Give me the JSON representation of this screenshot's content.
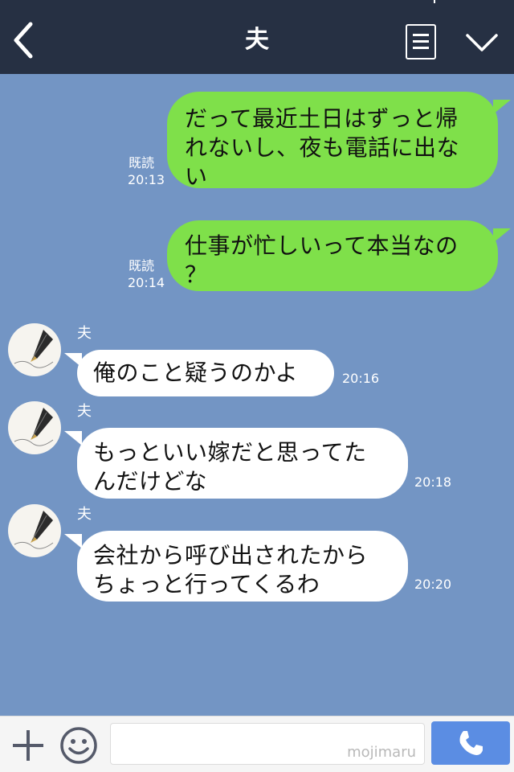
{
  "header": {
    "title": "夫",
    "back_icon": "chevron-left-icon",
    "notes_icon": "note-list-icon",
    "menu_icon": "chevron-down-icon"
  },
  "messages": [
    {
      "direction": "out",
      "lines": [
        "だって最近土日はずっと帰",
        "れないし、夜も電話に出な",
        "い"
      ],
      "read": "既読",
      "time": "20:13"
    },
    {
      "direction": "out",
      "lines": [
        "仕事が忙しいって本当なの",
        "？"
      ],
      "read": "既読",
      "time": "20:14"
    },
    {
      "direction": "in",
      "sender": "夫",
      "lines": [
        "俺のこと疑うのかよ"
      ],
      "time": "20:16"
    },
    {
      "direction": "in",
      "sender": "夫",
      "lines": [
        "もっといい嫁だと思ってた",
        "んだけどな"
      ],
      "time": "20:18"
    },
    {
      "direction": "in",
      "sender": "夫",
      "lines": [
        "会社から呼び出されたから",
        "ちょっと行ってくるわ"
      ],
      "time": "20:20"
    }
  ],
  "footer": {
    "input_placeholder": "mojimaru",
    "plus_icon": "plus-icon",
    "emoji_icon": "smiley-icon",
    "call_icon": "phone-icon"
  },
  "colors": {
    "header_bg": "#263043",
    "chat_bg": "#7395c4",
    "outgoing_bubble": "#7fe04a",
    "incoming_bubble": "#ffffff",
    "call_button": "#5b8de3"
  }
}
